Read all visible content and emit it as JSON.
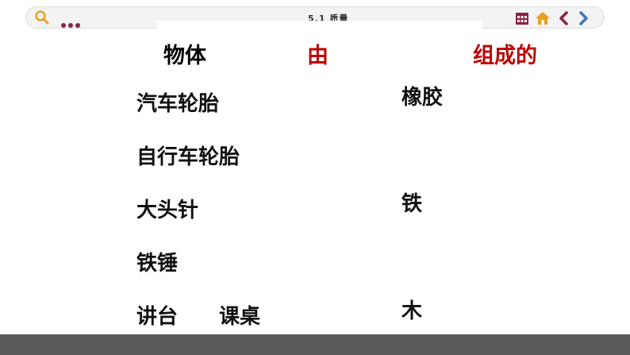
{
  "topbar": {
    "title": "5.1 质量",
    "icons": [
      "search-icon",
      "dots-menu-icon",
      "calendar-icon",
      "home-icon",
      "prev-arrow-icon",
      "next-arrow-icon"
    ],
    "colors": {
      "accent": "#8b2346",
      "home": "#e8a020",
      "nav": "#3c78b4"
    }
  },
  "headers": {
    "object": "物体",
    "by": "由",
    "made_of": "组成的"
  },
  "objects": [
    "汽车轮胎",
    "自行车轮胎",
    "大头针",
    "铁锤",
    "讲台",
    "课桌"
  ],
  "materials": [
    "橡胶",
    "铁",
    "木"
  ]
}
